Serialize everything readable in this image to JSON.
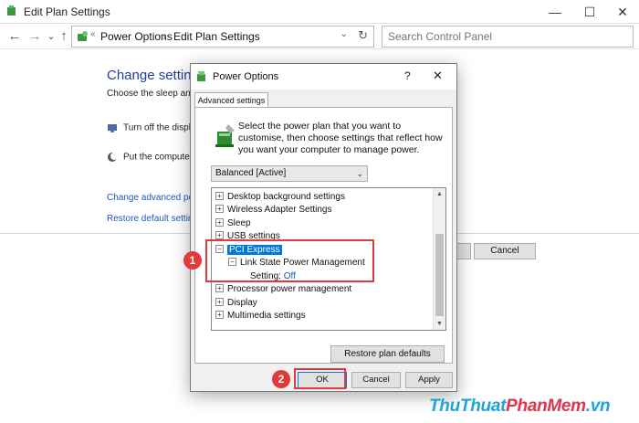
{
  "window": {
    "title": "Edit Plan Settings",
    "minimize": "—",
    "maximize": "☐",
    "close": "✕"
  },
  "nav": {
    "back": "←",
    "forward": "→",
    "dropdown": "⌄",
    "up": "↑",
    "breadcrumb_sep0": "«",
    "breadcrumbs": [
      "Power Options",
      "Edit Plan Settings"
    ],
    "breadcrumb_sep": "›",
    "address_dropdown": "⌄",
    "refresh": "↻",
    "search_placeholder": "Search Control Panel"
  },
  "background": {
    "heading": "Change settings",
    "subheading": "Choose the sleep and di",
    "row1": "Turn off the display",
    "row2": "Put the computer t",
    "link1": "Change advanced powe",
    "link2": "Restore default settings",
    "save_button": "",
    "cancel_button": "Cancel"
  },
  "dialog": {
    "title": "Power Options",
    "help": "?",
    "close": "✕",
    "tab": "Advanced settings",
    "description": "Select the power plan that you want to customise, then choose settings that reflect how you want your computer to manage power.",
    "plan_selected": "Balanced [Active]",
    "plan_arrow": "⌄",
    "tree": {
      "expand_symbol": "+",
      "collapse_symbol": "−",
      "items": [
        "Desktop background settings",
        "Wireless Adapter Settings",
        "Sleep",
        "USB settings",
        "PCI Express",
        "Link State Power Management",
        "Processor power management",
        "Display",
        "Multimedia settings"
      ],
      "setting_label": "Setting:",
      "setting_value": "Off",
      "scroll_up": "▲",
      "scroll_down": "▼"
    },
    "restore_button": "Restore plan defaults",
    "ok_button": "OK",
    "cancel_button": "Cancel",
    "apply_button": "Apply"
  },
  "callouts": [
    "1",
    "2"
  ],
  "watermark": {
    "part1": "ThuThuat",
    "part2": "PhanMem",
    "part3": ".vn"
  },
  "colors": {
    "highlight": "#e03a3a",
    "selection": "#0078d7",
    "link": "#1c57b8",
    "heading": "#1e3f9b"
  }
}
